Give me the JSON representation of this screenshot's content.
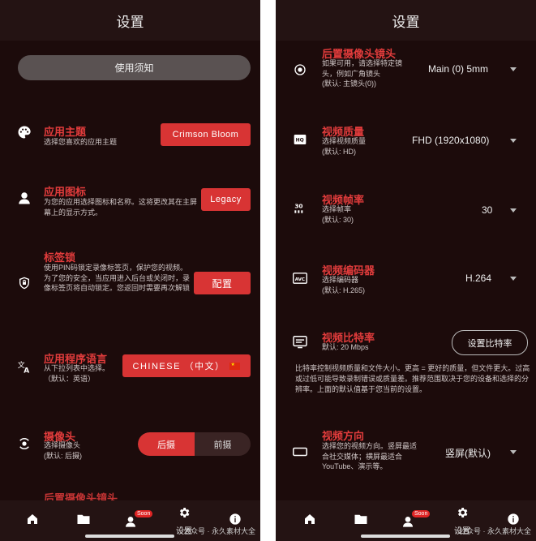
{
  "left": {
    "title": "设置",
    "notice_button": "使用须知",
    "theme": {
      "title": "应用主题",
      "desc": "选择您喜欢的应用主题",
      "value": "Crimson Bloom"
    },
    "app_icon": {
      "title": "应用图标",
      "desc": "为您的应用选择图标和名称。这将更改其在主屏幕上的显示方式。",
      "value": "Legacy"
    },
    "tab_lock": {
      "title": "标签锁",
      "desc": "使用PIN码锁定录像标签页，保护您的视频。为了您的安全，当应用进入后台或关闭时，录像标签页将自动锁定。您返回时需要再次解锁",
      "value": "配置"
    },
    "language": {
      "title": "应用程序语言",
      "desc": "从下拉列表中选择。（默认：英语）",
      "value": "CHINESE （中文）"
    },
    "camera": {
      "title": "摄像头",
      "desc": "选择摄像头\n(默认: 后摄)",
      "option_back": "后摄",
      "option_front": "前摄"
    },
    "partial_title": "后置摄像头镜头"
  },
  "right": {
    "title": "设置",
    "rear_lens": {
      "title": "后置摄像头镜头",
      "desc": "如果可用，请选择特定镜头，例如广角镜头\n(默认: 主镜头(0))",
      "value": "Main (0) 5mm"
    },
    "video_quality": {
      "title": "视频质量",
      "desc": "选择视频质量\n(默认: HD)",
      "value": "FHD (1920x1080)"
    },
    "frame_rate": {
      "title": "视频帧率",
      "desc": "选择帧率\n(默认: 30)",
      "value": "30"
    },
    "encoder": {
      "title": "视频编码器",
      "desc": "选择编码器\n(默认: H.265)",
      "value": "H.264"
    },
    "bitrate": {
      "title": "视频比特率",
      "desc": "默认: 20 Mbps",
      "button": "设置比特率",
      "note": "比特率控制视频质量和文件大小。更高 = 更好的质量，但文件更大。过高或过低可能导致录制错误或质量差。推荐范围取决于您的设备和选择的分辨率。上面的默认值基于您当前的设置。"
    },
    "orientation": {
      "title": "视频方向",
      "desc": "选择您的视频方向。竖屏最适合社交媒体；横屏最适合 YouTube、演示等。",
      "value": "竖屏(默认)"
    }
  },
  "nav": {
    "badge": "Soon",
    "settings_label": "设置"
  },
  "watermark": "公众号 · 永久素材大全",
  "colors": {
    "accent": "#d83434",
    "title_red": "#e23c3c",
    "background": "#1c0b0b",
    "bar": "#241313"
  }
}
